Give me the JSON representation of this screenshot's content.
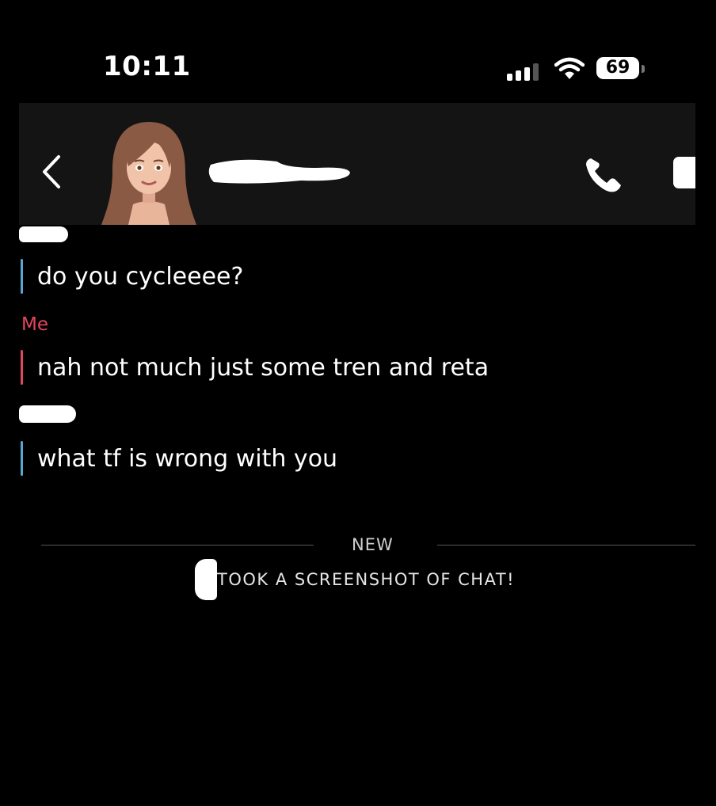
{
  "status_bar": {
    "time": "10:11",
    "battery_level": "69",
    "signal_bars_active": 3,
    "signal_bars_total": 4
  },
  "header": {
    "back_icon": "chevron-left-icon",
    "avatar_icon": "bitmoji-avatar",
    "call_icon": "phone-icon",
    "video_icon": "video-icon"
  },
  "messages": [
    {
      "sender": "them",
      "text": "do you cycleeee?"
    },
    {
      "sender": "me",
      "sender_label": "Me",
      "text": "nah not much just some tren and reta"
    },
    {
      "sender": "them",
      "text": "what tf is wrong with you"
    }
  ],
  "divider": {
    "label": "NEW"
  },
  "notice": {
    "text": "TOOK A SCREENSHOT OF CHAT!"
  },
  "colors": {
    "background": "#000000",
    "header_bg": "#141414",
    "them_accent": "#58a6d6",
    "me_accent": "#e2465d"
  }
}
